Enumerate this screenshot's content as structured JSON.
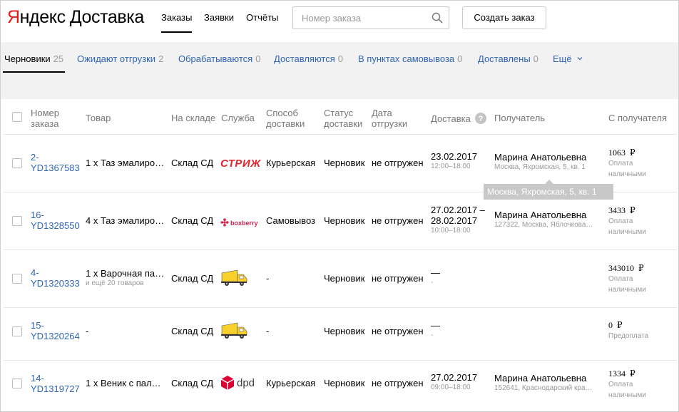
{
  "header": {
    "logo_brand": "Яндекс",
    "logo_product": "Доставка",
    "nav": [
      "Заказы",
      "Заявки",
      "Отчёты"
    ],
    "search_placeholder": "Номер заказа",
    "create_button": "Создать заказ"
  },
  "status_tabs": [
    {
      "label": "Черновики",
      "count": "25"
    },
    {
      "label": "Ожидают отгрузки",
      "count": "2"
    },
    {
      "label": "Обрабатываются",
      "count": "0"
    },
    {
      "label": "Доставляются",
      "count": "0"
    },
    {
      "label": "В пунктах самовывоза",
      "count": "0"
    },
    {
      "label": "Доставлены",
      "count": "0"
    },
    {
      "label": "Ещё",
      "count": ""
    }
  ],
  "table": {
    "headers": {
      "order_line1": "Номер",
      "order_line2": "заказа",
      "goods": "Товар",
      "warehouse": "На складе",
      "service": "Служба",
      "method_line1": "Способ",
      "method_line2": "доставки",
      "status_line1": "Статус",
      "status_line2": "доставки",
      "ship_line1": "Дата",
      "ship_line2": "отгрузки",
      "delivery": "Доставка",
      "recipient": "Получатель",
      "from_recipient": "С получателя"
    },
    "rows": [
      {
        "order_line1": "2-",
        "order_line2": "YD1367583",
        "goods": "1 x Таз эмалиро…",
        "goods_sub": "",
        "warehouse": "Склад СД",
        "service": "strizh",
        "method": "Курьерская",
        "status": "Черновик",
        "shipment": "не отгружен",
        "delivery_date": "23.02.2017",
        "delivery_date2": "",
        "delivery_time": "12:00–18:00",
        "recipient_name": "Марина Анатольевна",
        "recipient_address": "Москва, Яхромская, 5, кв. 1",
        "amount": "1063",
        "currency": "₽",
        "pay_line1": "Оплата",
        "pay_line2": "наличными"
      },
      {
        "order_line1": "16-",
        "order_line2": "YD1328550",
        "goods": "4 x Таз эмалиро…",
        "goods_sub": "",
        "warehouse": "Склад СД",
        "service": "boxberry",
        "method": "Самовывоз",
        "status": "Черновик",
        "shipment": "не отгружен",
        "delivery_date": "27.02.2017 –",
        "delivery_date2": "28.02.2017",
        "delivery_time": "10:00–18:00",
        "recipient_name": "Марина Анатольевна",
        "recipient_address": "127322, Москва, Яблочкова…",
        "amount": "3433",
        "currency": "₽",
        "pay_line1": "Оплата",
        "pay_line2": "наличными"
      },
      {
        "order_line1": "4-",
        "order_line2": "YD1320333",
        "goods": "1 x Варочная па…",
        "goods_sub": "и ещё 20 товаров",
        "warehouse": "Склад СД",
        "service": "truck",
        "method": "-",
        "status": "Черновик",
        "shipment": "не отгружен",
        "delivery_date": "—",
        "delivery_date2": "",
        "delivery_time": "-",
        "recipient_name": "",
        "recipient_address": "",
        "amount": "343010",
        "currency": "₽",
        "pay_line1": "Оплата",
        "pay_line2": "наличными"
      },
      {
        "order_line1": "15-",
        "order_line2": "YD1320264",
        "goods": "-",
        "goods_sub": "",
        "warehouse": "Склад СД",
        "service": "truck",
        "method": "-",
        "status": "Черновик",
        "shipment": "не отгружен",
        "delivery_date": "—",
        "delivery_date2": "",
        "delivery_time": "-",
        "recipient_name": "",
        "recipient_address": "",
        "amount": "0",
        "currency": "₽",
        "pay_line1": "Предоплата",
        "pay_line2": ""
      },
      {
        "order_line1": "14-",
        "order_line2": "YD1319727",
        "goods": "1 x Веник с пал…",
        "goods_sub": "",
        "warehouse": "Склад СД",
        "service": "dpd",
        "method": "Курьерская",
        "status": "Черновик",
        "shipment": "не отгружен",
        "delivery_date": "27.02.2017",
        "delivery_date2": "",
        "delivery_time": "09:00–18:00",
        "recipient_name": "Марина Анатольевна",
        "recipient_address": "152641, Краснодарский кра…",
        "amount": "1334",
        "currency": "₽",
        "pay_line1": "Оплата",
        "pay_line2": "наличными"
      }
    ]
  },
  "services": {
    "strizh": "СТРИЖ",
    "boxberry": "boxberry",
    "dpd": "dpd"
  },
  "tooltip": "Москва, Яхромская, 5, кв. 1",
  "colors": {
    "link": "#2f65b5",
    "brand_red": "#e21a1a",
    "strizh_red": "#e3262d",
    "boxberry_red": "#d0214a",
    "dpd_red": "#dc0032",
    "truck_yellow": "#f7d02c"
  }
}
